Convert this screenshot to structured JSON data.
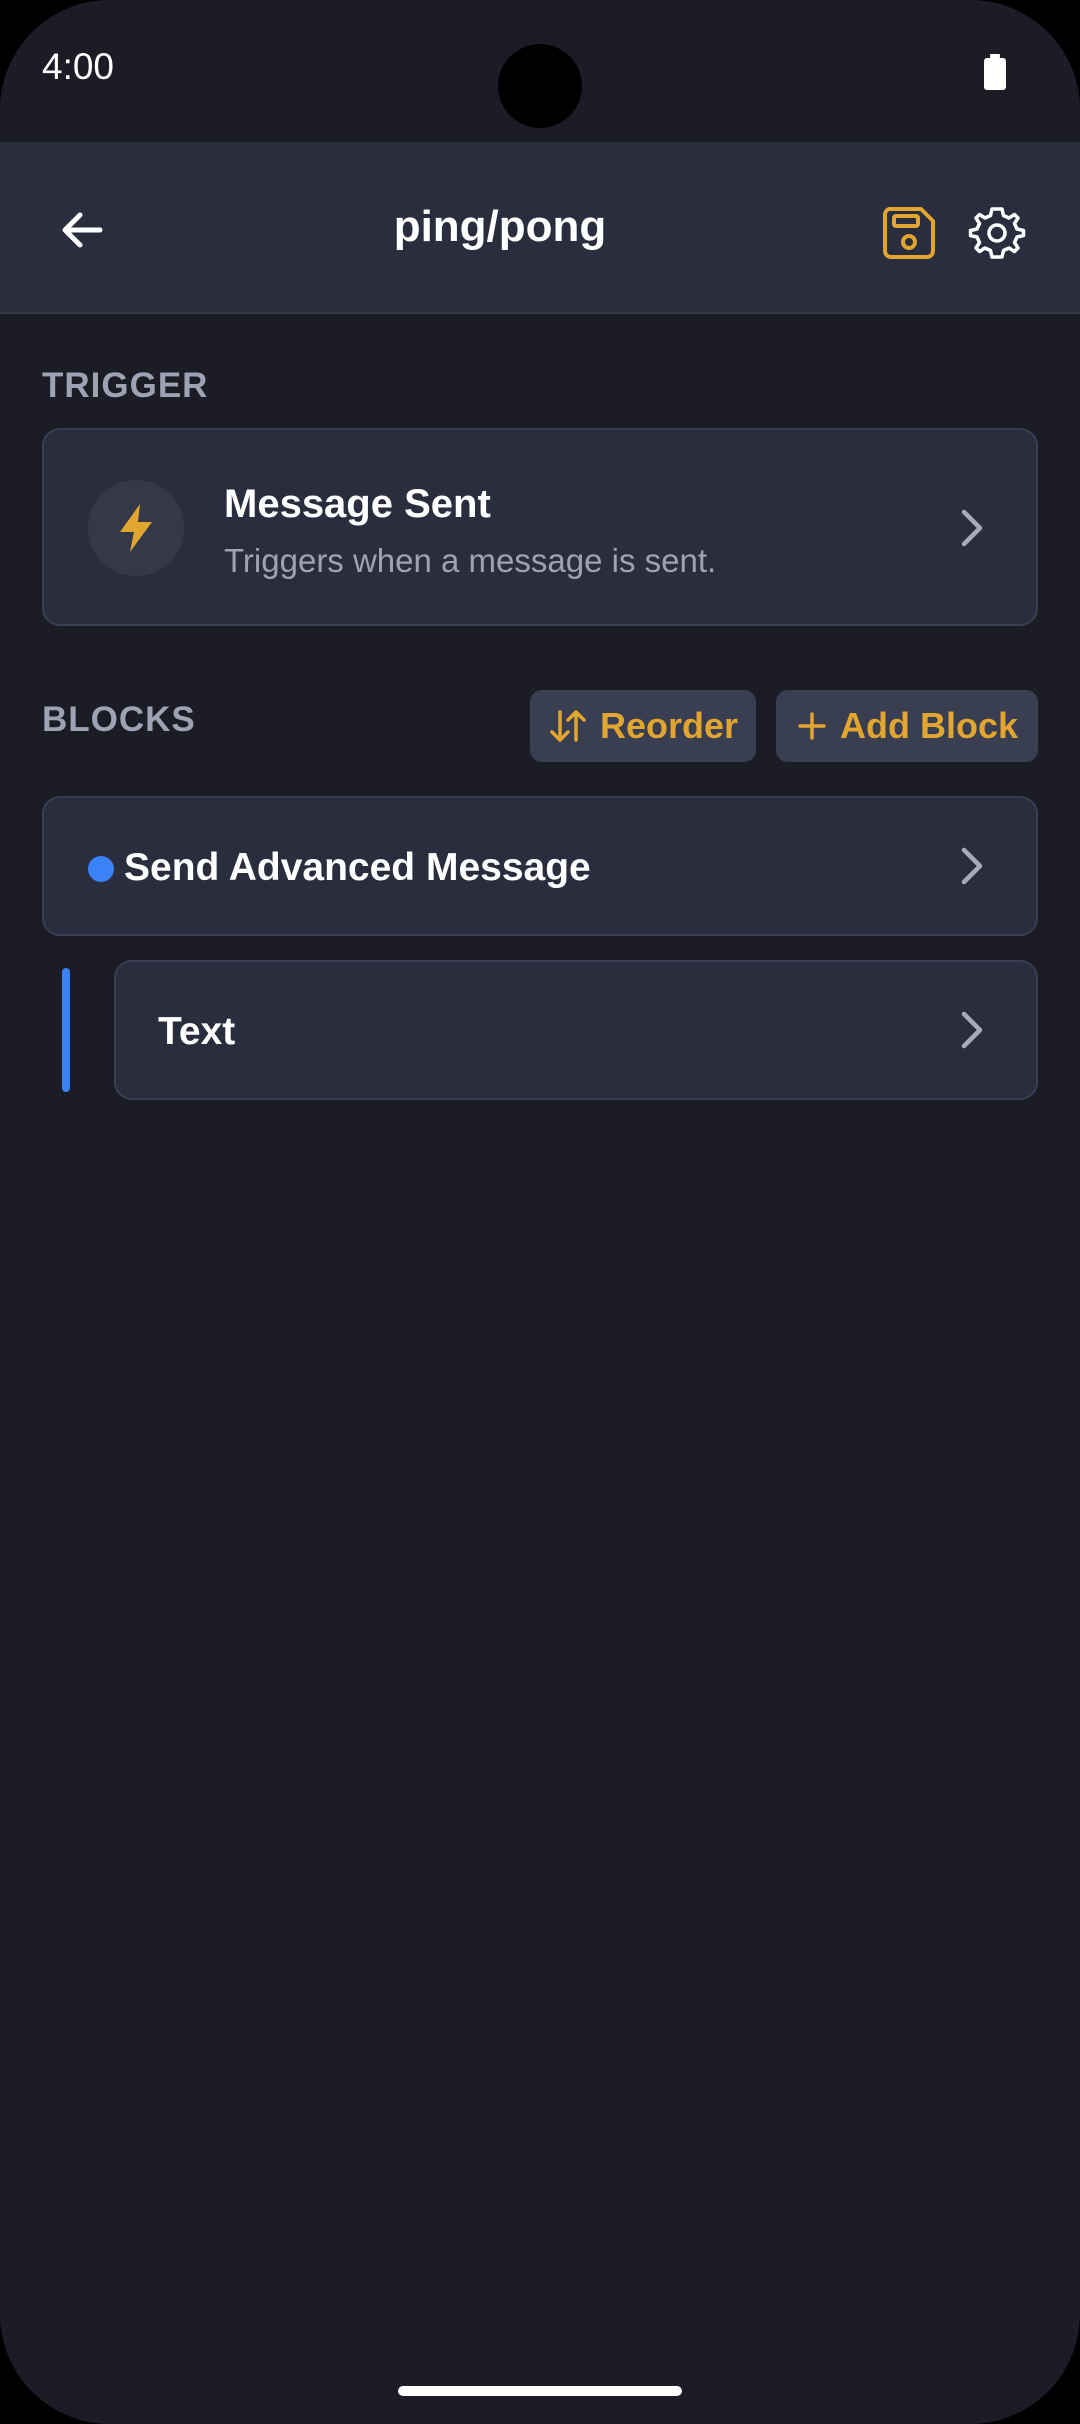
{
  "status_bar": {
    "time": "4:00"
  },
  "app_bar": {
    "title": "ping/pong"
  },
  "trigger_section": {
    "label": "TRIGGER",
    "card": {
      "title": "Message Sent",
      "description": "Triggers when a message is sent."
    }
  },
  "blocks_section": {
    "label": "BLOCKS",
    "reorder_label": "Reorder",
    "add_block_label": "Add Block",
    "items": [
      {
        "title": "Send Advanced Message",
        "dot_color": "#3b82f6"
      },
      {
        "title": "Text"
      }
    ]
  },
  "colors": {
    "accent": "#e0a630",
    "background": "#1b1c26",
    "surface": "#2a2d3e",
    "block_indicator": "#3b82f6"
  },
  "icons": [
    "back-arrow-icon",
    "save-icon",
    "gear-icon",
    "lightning-icon",
    "chevron-right-icon",
    "reorder-icon",
    "plus-icon",
    "battery-icon"
  ]
}
